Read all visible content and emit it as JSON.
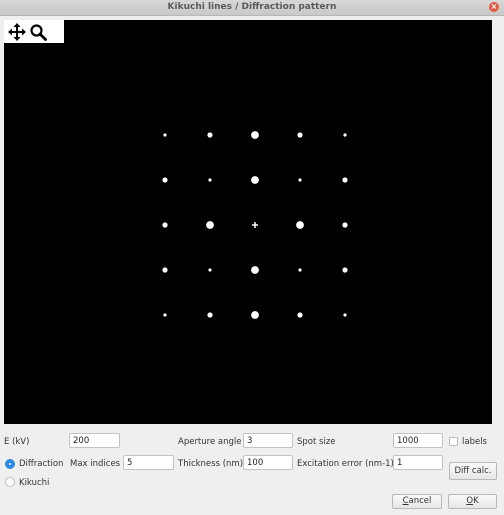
{
  "window": {
    "title": "Kikuchi lines / Diffraction pattern"
  },
  "toolbar": {
    "pan_icon": "pan-icon",
    "zoom_icon": "zoom-icon"
  },
  "pattern": {
    "background": "#000000",
    "grid": [
      [
        "s",
        "m",
        "l",
        "m",
        "s"
      ],
      [
        "m",
        "s",
        "l",
        "s",
        "m"
      ],
      [
        "m",
        "l",
        "+",
        "l",
        "m"
      ],
      [
        "m",
        "s",
        "l",
        "s",
        "m"
      ],
      [
        "s",
        "m",
        "l",
        "m",
        "s"
      ]
    ]
  },
  "form": {
    "energy_label": "E (kV)",
    "energy_value": "200",
    "aperture_label": "Aperture angle",
    "aperture_value": "3",
    "spot_size_label": "Spot size",
    "spot_size_value": "1000",
    "labels_checkbox": "labels",
    "labels_checked": false,
    "mode_diffraction": "Diffraction",
    "mode_kikuchi": "Kikuchi",
    "selected_mode": "Diffraction",
    "max_indices_label": "Max indices",
    "max_indices_value": "5",
    "thickness_label": "Thickness (nm)",
    "thickness_value": "100",
    "excitation_label": "Excitation error (nm-1)",
    "excitation_value": "1",
    "diff_calc_button": "Diff calc."
  },
  "dialog": {
    "cancel_prefix": "",
    "cancel_accel": "C",
    "cancel_rest": "ancel",
    "ok_prefix": "",
    "ok_accel": "O",
    "ok_rest": "K"
  }
}
